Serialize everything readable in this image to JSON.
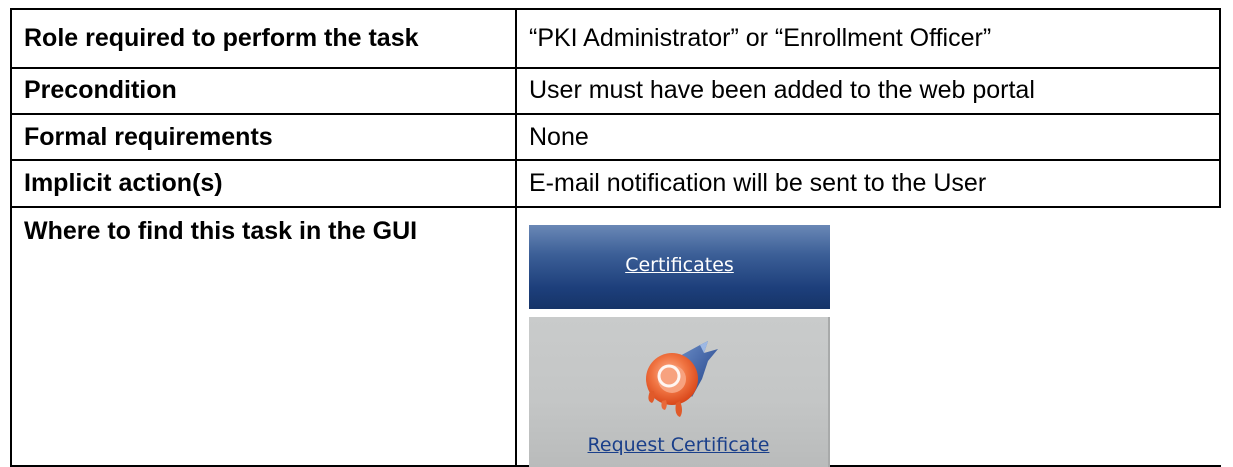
{
  "rows": [
    {
      "label": "Role required to perform the task",
      "value": "“PKI Administrator” or “Enrollment Officer”"
    },
    {
      "label": "Precondition",
      "value": "User must have been added to the web portal"
    },
    {
      "label": "Formal requirements",
      "value": "None"
    },
    {
      "label": "Implicit action(s)",
      "value": "E-mail notification will be sent to the User"
    },
    {
      "label": "Where to find this task in the GUI",
      "value": ""
    }
  ],
  "gui": {
    "nav_tab_label": "Certificates",
    "action_label": "Request Certificate",
    "action_icon": "certificate-request-icon",
    "colors": {
      "nav_tab_top": "#6a88b6",
      "nav_tab_bottom": "#163468",
      "action_panel": "#c6c8c8",
      "action_link": "#1a3f8a"
    }
  }
}
